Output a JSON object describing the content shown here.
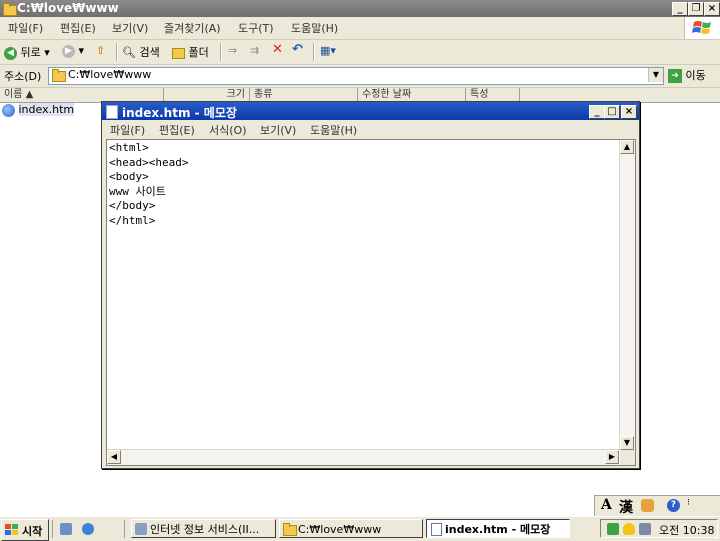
{
  "explorer": {
    "title": "C:₩love₩www",
    "menu": [
      "파일(F)",
      "편집(E)",
      "보기(V)",
      "즐겨찾기(A)",
      "도구(T)",
      "도움말(H)"
    ],
    "toolbar": {
      "back": "뒤로",
      "search": "검색",
      "folders": "폴더"
    },
    "address": {
      "label": "주소(D)",
      "value": "C:₩love₩www",
      "go": "이동"
    },
    "columns": [
      "이름",
      "크기",
      "종류",
      "수정한 날짜",
      "특성"
    ],
    "files": [
      {
        "name": "index.htm"
      }
    ]
  },
  "notepad": {
    "title": "index.htm - 메모장",
    "menu": [
      "파일(F)",
      "편집(E)",
      "서식(O)",
      "보기(V)",
      "도움말(H)"
    ],
    "content": "<html>\n<head><head>\n<body>\nwww 사이트\n</body>\n</html>"
  },
  "taskbar": {
    "start": "시작",
    "tasks": [
      "인터넷 정보 서비스(II...",
      "C:₩love₩www",
      "index.htm - 메모장"
    ],
    "clock": "오전 10:38",
    "ime": {
      "mode": "A",
      "hanja": "漢"
    }
  }
}
